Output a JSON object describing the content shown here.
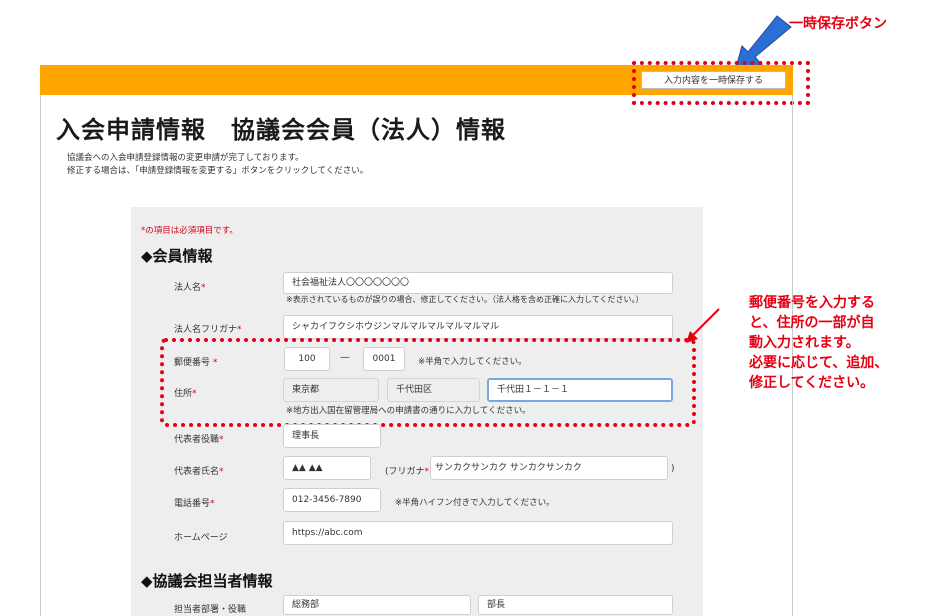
{
  "callouts": {
    "save_button": "一時保存ボタン",
    "postal": [
      "郵便番号を入力する",
      "と、住所の一部が自",
      "動入力されます。",
      "必要に応じて、追加、",
      "修正してください。"
    ]
  },
  "header": {
    "save_button": "入力内容を一時保存する"
  },
  "page": {
    "title": "入会申請情報　協議会会員（法人）情報",
    "intro_lines": [
      "協議会への入会申請登録情報の変更申請が完了しております。",
      "修正する場合は、「申請登録情報を変更する」ボタンをクリックしてください。"
    ]
  },
  "form": {
    "required_note": "*の項目は必須項目です。",
    "required_mark": "*",
    "member_section": "◆会員情報",
    "corp_name": {
      "label": "法人名",
      "value": "社会福祉法人〇〇〇〇〇〇〇",
      "hint": "※表示されているものが誤りの場合、修正してください。（法人格を含め正確に入力してください。）"
    },
    "corp_kana": {
      "label": "法人名フリガナ",
      "value": "シャカイフクシホウジンマルマルマルマルマルマル"
    },
    "postal": {
      "label": "郵便番号",
      "value1": "100",
      "dash": "—",
      "value2": "0001",
      "hint": "※半角で入力してください。"
    },
    "address": {
      "label": "住所",
      "prefecture": "東京都",
      "city": "千代田区",
      "street": "千代田１－１－１",
      "hint": "※地方出入国在留管理局への申請書の通りに入力してください。"
    },
    "rep_title": {
      "label": "代表者役職",
      "value": "理事長"
    },
    "rep_name": {
      "label": "代表者氏名",
      "value": "▲▲ ▲▲",
      "kana_prefix": "(フリガナ",
      "kana_value": "サンカクサンカク サンカクサンカク",
      "kana_suffix": ")"
    },
    "phone": {
      "label": "電話番号",
      "value": "012-3456-7890",
      "hint": "※半角ハイフン付きで入力してください。"
    },
    "homepage": {
      "label": "ホームページ",
      "value": "https://abc.com"
    },
    "contact_section": "◆協議会担当者情報",
    "contact_dept": {
      "label": "担当者部署・役職",
      "dept": "総務部",
      "position": "部長"
    }
  },
  "colors": {
    "accent_orange": "#ffa500",
    "callout_red": "#e60012",
    "arrow_blue": "#2b6fd6"
  }
}
